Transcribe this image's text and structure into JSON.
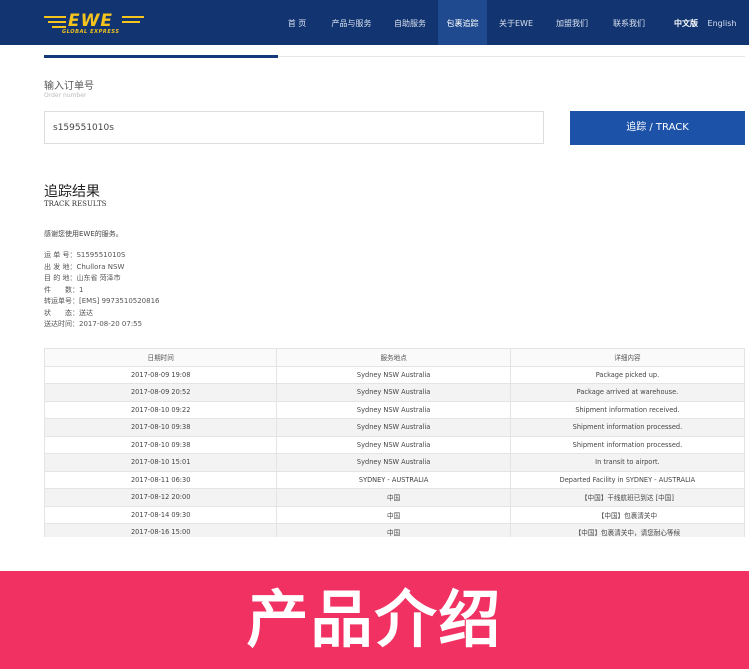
{
  "header": {
    "logo_text": "EWE",
    "logo_sub": "GLOBAL EXPRESS",
    "nav": [
      "首 页",
      "产品与服务",
      "自助服务",
      "包裹追踪",
      "关于EWE",
      "加盟我们",
      "联系我们"
    ],
    "active_index": 3,
    "lang_cn": "中文版",
    "lang_en": "English"
  },
  "order": {
    "label": "输入订单号",
    "sub": "Order number",
    "value": "s159551010s",
    "button": "追踪 / TRACK"
  },
  "results": {
    "title": "追踪结果",
    "subtitle": "TRACK RESULTS",
    "thanks": "感谢您使用EWE的服务。",
    "info": [
      "运 单 号：S159551010S",
      "出 发 地：Chullora NSW",
      "目 的 地：山东省 菏泽市",
      "件　　数：1",
      "转运单号：[EMS] 9973510520816",
      "状　　态：送达",
      "送达时间：2017-08-20 07:55"
    ]
  },
  "table": {
    "headers": [
      "日期时间",
      "服务地点",
      "详细内容"
    ],
    "rows": [
      [
        "2017-08-09 19:08",
        "Sydney NSW Australia",
        "Package picked up."
      ],
      [
        "2017-08-09 20:52",
        "Sydney NSW Australia",
        "Package arrived at warehouse."
      ],
      [
        "2017-08-10 09:22",
        "Sydney NSW Australia",
        "Shipment information received."
      ],
      [
        "2017-08-10 09:38",
        "Sydney NSW Australia",
        "Shipment information processed."
      ],
      [
        "2017-08-10 09:38",
        "Sydney NSW Australia",
        "Shipment information processed."
      ],
      [
        "2017-08-10 15:01",
        "Sydney NSW Australia",
        "In transit to airport."
      ],
      [
        "2017-08-11 06:30",
        "SYDNEY - AUSTRALIA",
        "Departed Facility in SYDNEY - AUSTRALIA"
      ],
      [
        "2017-08-12 20:00",
        "中国",
        "【中国】干线航班已到达 [中国]"
      ],
      [
        "2017-08-14 09:30",
        "中国",
        "【中国】包裹清关中"
      ],
      [
        "2017-08-16 15:00",
        "中国",
        "【中国】包裹清关中，请您耐心等候"
      ]
    ]
  },
  "banner": {
    "text": "产品介绍"
  },
  "colors": {
    "header_bg": "#123572",
    "logo": "#f5c41c",
    "track_button": "#1c52a8",
    "banner_bg": "#f23163"
  }
}
